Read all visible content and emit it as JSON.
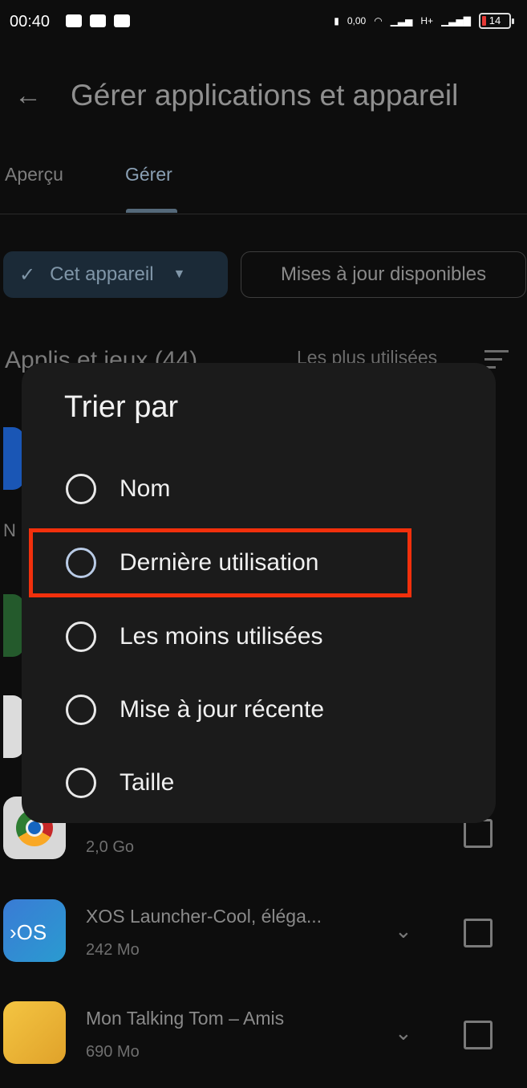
{
  "status_bar": {
    "time": "00:40",
    "right_small": "0,00",
    "network": "H+",
    "battery": "14"
  },
  "header": {
    "back_icon": "arrow-left-icon",
    "title": "Gérer applications et appareil"
  },
  "tabs": [
    {
      "label": "Aperçu",
      "active": false
    },
    {
      "label": "Gérer",
      "active": true
    }
  ],
  "filters": {
    "device_chip": "Cet appareil",
    "updates_chip": "Mises à jour disponibles"
  },
  "list": {
    "section_title": "Applis et jeux (44)",
    "sort_label": "Les plus utilisées",
    "apps": [
      {
        "name": "",
        "size": "2,0 Go",
        "icon": "chrome-icon"
      },
      {
        "name": "XOS Launcher-Cool, éléga...",
        "size": "242 Mo",
        "icon": "xos-launcher-icon"
      },
      {
        "name": "Mon Talking Tom – Amis",
        "size": "690 Mo",
        "icon": "talking-tom-icon"
      }
    ]
  },
  "dialog": {
    "title": "Trier par",
    "options": [
      "Nom",
      "Dernière utilisation",
      "Les moins utilisées",
      "Mise à jour récente",
      "Taille"
    ]
  },
  "colors": {
    "highlight_box": "#f2300c",
    "dialog_bg": "#1b1b1b",
    "page_bg": "#0d0d0d"
  }
}
